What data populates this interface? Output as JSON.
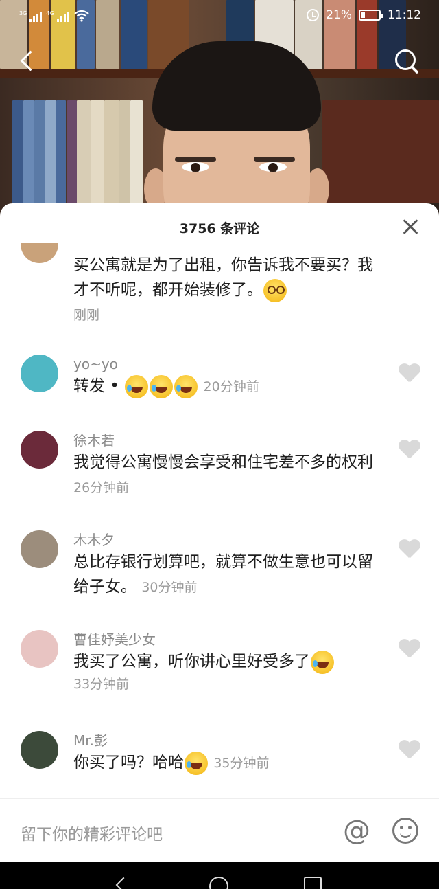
{
  "status_bar": {
    "signal1": "3G",
    "signal2": "4G",
    "battery": "21%",
    "battery_level": 0.21,
    "time": "11:12"
  },
  "nav": {
    "back_icon": "back-chevron-icon",
    "search_icon": "search-icon"
  },
  "sheet": {
    "title": "3756 条评论",
    "close_icon": "close-icon"
  },
  "comments": [
    {
      "name": "",
      "text": "买公寓就是为了出租，你告诉我不要买？我才不听呢，都开始装修了。",
      "emojis": [
        "shy-emoji"
      ],
      "time": "刚刚",
      "avatar_color": "#c9a27a"
    },
    {
      "name": "yo~yo",
      "text": "转发 •",
      "emojis": [
        "laugh-cry-emoji",
        "laugh-cry-emoji",
        "laugh-cry-emoji"
      ],
      "time": "20分钟前",
      "avatar_color": "#4fb7c4"
    },
    {
      "name": "徐木若",
      "text": "我觉得公寓慢慢会享受和住宅差不多的权利",
      "emojis": [],
      "time": "26分钟前",
      "avatar_color": "#6b2a3a"
    },
    {
      "name": "木木夕",
      "text": "总比存银行划算吧，就算不做生意也可以留给子女。",
      "emojis": [],
      "time": "30分钟前",
      "avatar_color": "#9c8d7c"
    },
    {
      "name": "曹佳妤美少女",
      "text": "我买了公寓，听你讲心里好受多了",
      "emojis": [
        "laugh-cry-emoji"
      ],
      "time": "33分钟前",
      "avatar_color": "#e8c4c2"
    },
    {
      "name": "Mr.彭",
      "text": "你买了吗？哈哈",
      "emojis": [
        "laugh-cry-emoji"
      ],
      "time": "35分钟前",
      "avatar_color": "#3c4a3a"
    }
  ],
  "input": {
    "placeholder": "留下你的精彩评论吧",
    "at_icon": "at-icon",
    "emoji_icon": "smile-icon"
  },
  "system_nav": {
    "back": "nav-back-icon",
    "home": "nav-home-icon",
    "recent": "nav-recent-icon"
  }
}
